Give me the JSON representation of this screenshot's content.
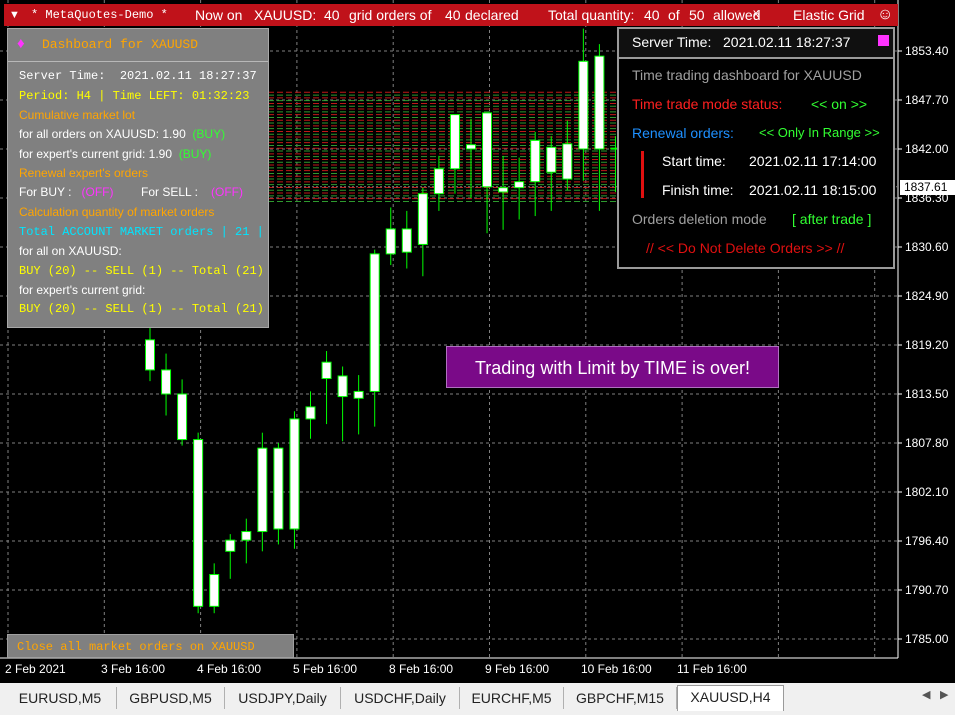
{
  "topbar": {
    "menu_arrow": "▼",
    "account": "* MetaQuotes-Demo *",
    "now_on": "Now on",
    "symbol": "XAUUSD:",
    "grid_count": "40",
    "grid_text": "grid orders of",
    "declared_count": "40",
    "declared_text": "declared",
    "total_qty_text": "Total quantity:",
    "total_qty": "40",
    "of_text": "of",
    "allowed_count": "50",
    "allowed_text": "allowed",
    "close_icon": "x",
    "ea_name": "Elastic Grid",
    "smiley": "☺"
  },
  "left_panel": {
    "title_icon": "♦",
    "title": "Dashboard for XAUUSD",
    "server_time_label": "Server Time:",
    "server_time": "2021.02.11 18:27:37",
    "period": "Period: H4 | Time LEFT: 01:32:23",
    "cumulative_title": "Cumulative market lot",
    "all_orders_text": "for all orders on XAUUSD: 1.90",
    "all_orders_side": "(BUY)",
    "expert_grid_text": "for expert's current grid: 1.90",
    "expert_grid_side": "(BUY)",
    "renewal_title": "Renewal  expert's  orders",
    "for_buy": "For BUY :",
    "buy_state": "(OFF)",
    "for_sell": "For SELL :",
    "sell_state": "(OFF)",
    "calc_title": "Calculation quantity of market orders",
    "total_account": "Total ACCOUNT MARKET orders | 21 |",
    "for_all_label": "for all  on XAUUSD:",
    "all_counts": "BUY (20) -- SELL (1) -- Total (21)",
    "for_expert_label": "for expert's current grid:",
    "expert_counts": "BUY (20) -- SELL (1) -- Total (21)"
  },
  "close_button": {
    "label": "Close all market orders on XAUUSD"
  },
  "right_panel": {
    "server_time_label": "Server Time:",
    "server_time": "2021.02.11 18:27:37",
    "dashboard_title": "Time trading dashboard for XAUUSD",
    "mode_status_label": "Time trade mode status:",
    "mode_status_value": "<< on >>",
    "renewal_label": "Renewal orders:",
    "renewal_value": "<< Only In Range >>",
    "start_label": "Start  time:",
    "start_value": "2021.02.11 17:14:00",
    "finish_label": "Finish time:",
    "finish_value": "2021.02.11 18:15:00",
    "deletion_label": "Orders deletion mode",
    "deletion_value": "[ after trade ]",
    "do_not_delete": "//  <<  Do Not Delete Orders  >>  //"
  },
  "banner": {
    "text": "Trading with Limit by TIME is over!"
  },
  "price_axis": {
    "labels": [
      "1853.40",
      "1847.70",
      "1842.00",
      "1836.30",
      "1830.60",
      "1824.90",
      "1819.20",
      "1813.50",
      "1807.80",
      "1802.10",
      "1796.40",
      "1790.70",
      "1785.00"
    ],
    "current_price": "1837.61"
  },
  "time_axis": {
    "labels": [
      "2 Feb 2021",
      "3 Feb 16:00",
      "4 Feb 16:00",
      "5 Feb 16:00",
      "8 Feb 16:00",
      "9 Feb 16:00",
      "10 Feb 16:00",
      "11 Feb 16:00"
    ]
  },
  "tabs": [
    {
      "label": "EURUSD,M5",
      "active": false
    },
    {
      "label": "GBPUSD,M5",
      "active": false
    },
    {
      "label": "USDJPY,Daily",
      "active": false
    },
    {
      "label": "USDCHF,Daily",
      "active": false
    },
    {
      "label": "EURCHF,M5",
      "active": false
    },
    {
      "label": "GBPCHF,M15",
      "active": false
    },
    {
      "label": "XAUUSD,H4",
      "active": true
    }
  ],
  "tab_nav": {
    "left": "◀",
    "right": "▶"
  },
  "colors": {
    "chart_bg": "#000000",
    "candle_up": "#00ff00",
    "candle_body": "#ffffff",
    "grid": "#808080",
    "topbar": "#c0121a",
    "banner": "#7a0a88"
  },
  "candles": [
    {
      "o": 1819.8,
      "h": 1823.5,
      "l": 1815.0,
      "c": 1816.3
    },
    {
      "o": 1816.3,
      "h": 1818.2,
      "l": 1811.0,
      "c": 1813.5
    },
    {
      "o": 1813.5,
      "h": 1815.2,
      "l": 1807.5,
      "c": 1808.2
    },
    {
      "o": 1808.2,
      "h": 1809.0,
      "l": 1788.0,
      "c": 1788.8
    },
    {
      "o": 1788.8,
      "h": 1793.8,
      "l": 1788.0,
      "c": 1792.5
    },
    {
      "o": 1795.2,
      "h": 1797.2,
      "l": 1792.0,
      "c": 1796.5
    },
    {
      "o": 1796.5,
      "h": 1799.0,
      "l": 1793.8,
      "c": 1797.5
    },
    {
      "o": 1797.5,
      "h": 1809.0,
      "l": 1795.2,
      "c": 1807.2
    },
    {
      "o": 1807.2,
      "h": 1807.8,
      "l": 1796.0,
      "c": 1797.8
    },
    {
      "o": 1797.8,
      "h": 1811.5,
      "l": 1795.5,
      "c": 1810.6
    },
    {
      "o": 1810.6,
      "h": 1813.8,
      "l": 1808.3,
      "c": 1812.0
    },
    {
      "o": 1815.3,
      "h": 1818.5,
      "l": 1810.0,
      "c": 1817.2
    },
    {
      "o": 1815.6,
      "h": 1816.7,
      "l": 1808.0,
      "c": 1813.2
    },
    {
      "o": 1813.0,
      "h": 1815.7,
      "l": 1808.8,
      "c": 1813.8
    },
    {
      "o": 1813.8,
      "h": 1830.3,
      "l": 1809.7,
      "c": 1829.8
    },
    {
      "o": 1829.8,
      "h": 1835.2,
      "l": 1828.5,
      "c": 1832.7
    },
    {
      "o": 1830.0,
      "h": 1834.8,
      "l": 1828.1,
      "c": 1832.7
    },
    {
      "o": 1830.9,
      "h": 1837.5,
      "l": 1827.2,
      "c": 1836.8
    },
    {
      "o": 1836.8,
      "h": 1841.2,
      "l": 1834.8,
      "c": 1839.7
    },
    {
      "o": 1839.7,
      "h": 1845.0,
      "l": 1836.8,
      "c": 1846.0
    },
    {
      "o": 1842.5,
      "h": 1845.5,
      "l": 1836.3,
      "c": 1842.0
    },
    {
      "o": 1837.6,
      "h": 1846.2,
      "l": 1832.2,
      "c": 1846.2
    },
    {
      "o": 1837.5,
      "h": 1841.2,
      "l": 1832.6,
      "c": 1837.0
    },
    {
      "o": 1837.5,
      "h": 1841.0,
      "l": 1833.8,
      "c": 1838.2
    },
    {
      "o": 1838.2,
      "h": 1844.0,
      "l": 1834.2,
      "c": 1843.0
    },
    {
      "o": 1839.3,
      "h": 1843.5,
      "l": 1834.8,
      "c": 1842.2
    },
    {
      "o": 1838.5,
      "h": 1845.3,
      "l": 1837.2,
      "c": 1842.6
    },
    {
      "o": 1842.0,
      "h": 1856.0,
      "l": 1838.3,
      "c": 1852.2
    },
    {
      "o": 1852.8,
      "h": 1854.2,
      "l": 1834.8,
      "c": 1842.0
    },
    {
      "o": 1842.0,
      "h": 1843.5,
      "l": 1837.0,
      "c": 1842.1
    }
  ]
}
